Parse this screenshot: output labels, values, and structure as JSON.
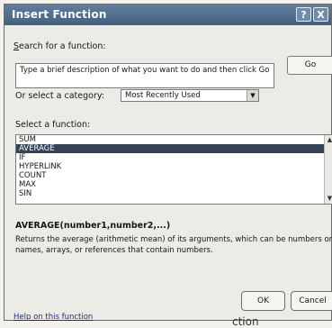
{
  "window": {
    "title": "Insert Function",
    "help_button": "?",
    "close_button": "X"
  },
  "search": {
    "label_prefix": "",
    "label_accel": "S",
    "label_rest": "earch for a function:",
    "value": "Type a brief description of what you want to do and then click Go",
    "go_label": "Go"
  },
  "category": {
    "label_accel": "",
    "label": "Or select a category:",
    "value": "Most Recently Used"
  },
  "functions": {
    "label_accel": "",
    "label": "Select a function:",
    "items": [
      {
        "label": "SUM",
        "selected": false
      },
      {
        "label": "AVERAGE",
        "selected": true
      },
      {
        "label": "IF",
        "selected": false
      },
      {
        "label": "HYPERLINK",
        "selected": false
      },
      {
        "label": "COUNT",
        "selected": false
      },
      {
        "label": "MAX",
        "selected": false
      },
      {
        "label": "SIN",
        "selected": false
      }
    ]
  },
  "details": {
    "signature": "AVERAGE(number1,number2,...)",
    "description": "Returns the average (arithmetic mean) of its arguments, which can be numbers or names, arrays, or references that contain numbers."
  },
  "footer": {
    "help_link": "Help on this function",
    "ok_label": "OK",
    "cancel_label": "Cancel"
  },
  "page_text": "ction",
  "icons": {
    "category_dropdown": "chevron-down-icon",
    "scroll_up": "chevron-up-icon",
    "scroll_down": "chevron-down-icon"
  }
}
